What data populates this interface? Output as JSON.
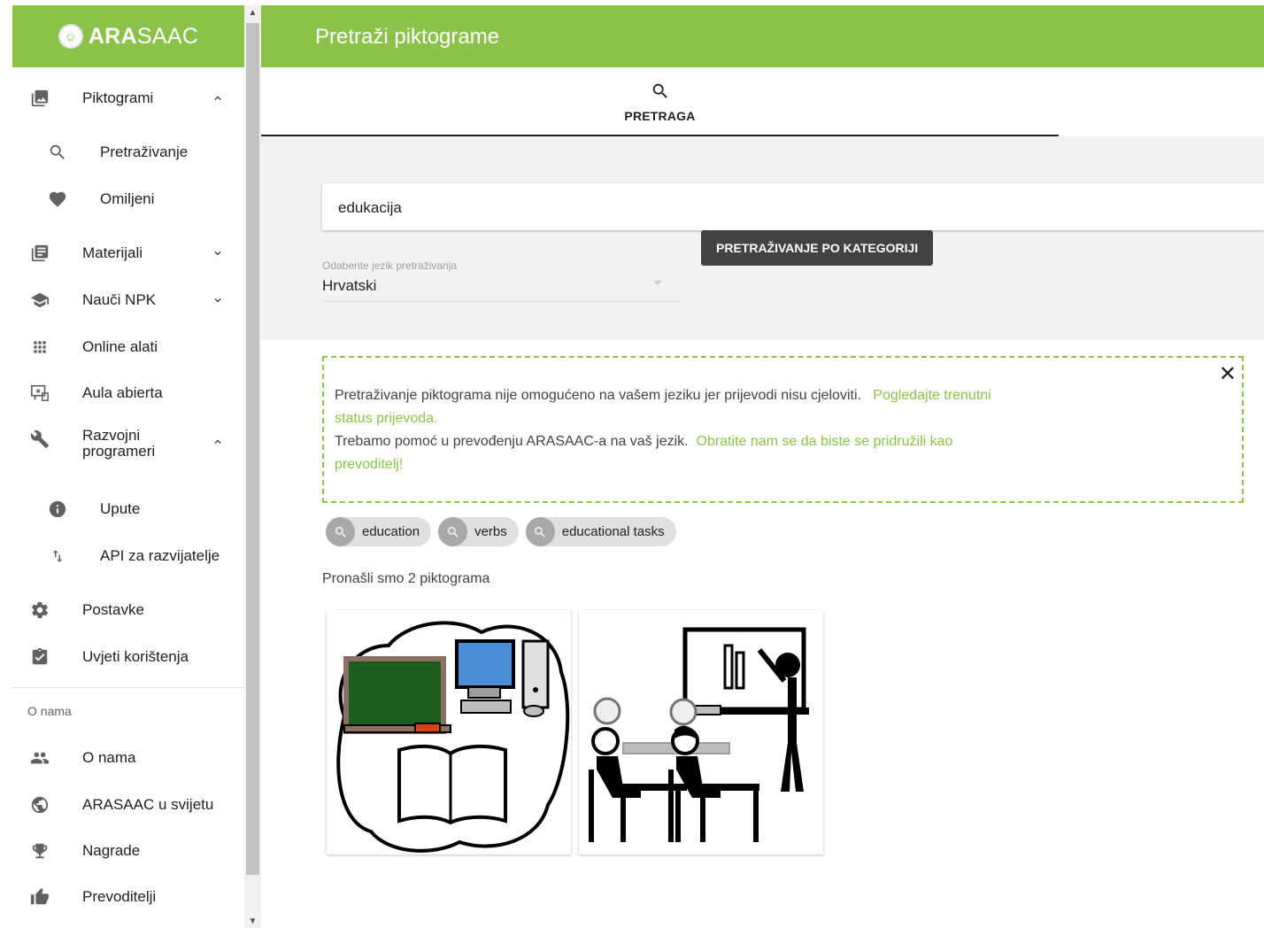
{
  "app": {
    "logo_bold": "ARA",
    "logo_rest": "SAAC"
  },
  "header": {
    "title": "Pretraži piktograme"
  },
  "sidebar": {
    "items": [
      {
        "label": "Piktogrami",
        "icon": "image-icon"
      },
      {
        "label": "Pretraživanje",
        "icon": "search-icon"
      },
      {
        "label": "Omiljeni",
        "icon": "heart-icon"
      },
      {
        "label": "Materijali",
        "icon": "library-icon"
      },
      {
        "label": "Nauči NPK",
        "icon": "school-icon"
      },
      {
        "label": "Online alati",
        "icon": "apps-icon"
      },
      {
        "label": "Aula abierta",
        "icon": "presentation-icon"
      },
      {
        "label": "Razvojni programeri",
        "icon": "wrench-icon"
      },
      {
        "label": "Upute",
        "icon": "info-icon"
      },
      {
        "label": "API za razvijatelje",
        "icon": "swap-vert-icon"
      },
      {
        "label": "Postavke",
        "icon": "settings-icon"
      },
      {
        "label": "Uvjeti korištenja",
        "icon": "assignment-icon"
      }
    ],
    "section_title": "O nama",
    "about_items": [
      {
        "label": "O nama",
        "icon": "people-icon"
      },
      {
        "label": "ARASAAC u svijetu",
        "icon": "globe-icon"
      },
      {
        "label": "Nagrade",
        "icon": "trophy-icon"
      },
      {
        "label": "Prevoditelji",
        "icon": "thumb-up-icon"
      }
    ]
  },
  "tabs": {
    "search_label": "PRETRAGA"
  },
  "search": {
    "value": "edukacija",
    "category_button": "PRETRAŽIVANJE PO KATEGORIJI",
    "language_label": "Odaberite jezik pretraživanja",
    "language_value": "Hrvatski"
  },
  "warning": {
    "text1": "Pretraživanje piktograma nije omogućeno na vašem jeziku jer prijevodi nisu cjeloviti.",
    "link1": "Pogledajte trenutni status prijevoda.",
    "text2": "Trebamo pomoć u prevođenju ARASAAC-a na vaš jezik.",
    "link2": "Obratite nam se da biste se pridružili kao prevoditelj!",
    "close": "✕"
  },
  "chips": [
    "education",
    "verbs",
    "educational tasks"
  ],
  "results": {
    "count_text": "Pronašli smo 2 piktograma"
  },
  "colors": {
    "brand": "#8bc34a",
    "chip_bg": "#e0e0e0",
    "tooltip_bg": "#424242"
  }
}
